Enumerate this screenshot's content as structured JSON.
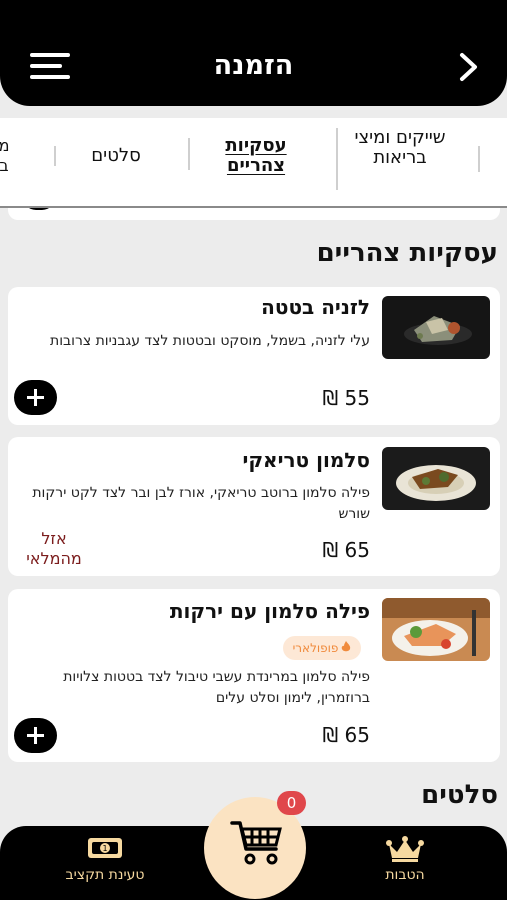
{
  "header": {
    "title": "הזמנה"
  },
  "tabs": [
    {
      "label": "שייקים ומיצי בריאות"
    },
    {
      "label": "עסקיות צהריים"
    },
    {
      "label": "סלטים"
    },
    {
      "label": "מ ב"
    }
  ],
  "section": {
    "title": "עסקיות צהריים"
  },
  "next_section": {
    "title": "סלטים"
  },
  "items": [
    {
      "name": "לזניה בטטה",
      "description": "עלי לזניה, בשמל, מוסקט ובטטות לצד עגבניות צרובות",
      "price": "55 ₪",
      "status": ""
    },
    {
      "name": "סלמון טריאקי",
      "description": "פילה סלמון ברוטב טריאקי, אורז לבן ובר לצד לקט ירקות שורש",
      "price": "65 ₪",
      "status": "אזל מהמלאי"
    },
    {
      "name": "פילה סלמון עם ירקות",
      "badge": "פופולארי",
      "description": "פילה סלמון במרינדת עשבי טיבול לצד בטטות צלויות ברוזמרין, לימון וסלט עלים",
      "price": "65 ₪",
      "status": ""
    }
  ],
  "bottom_nav": {
    "benefits_label": "הטבות",
    "budget_label": "טעינת תקציב",
    "cart_count": "0"
  },
  "colors": {
    "brand": "#000000",
    "accent": "#fbe3c2",
    "sold_out": "#7b1c1c",
    "badge": "#f08a3c"
  }
}
